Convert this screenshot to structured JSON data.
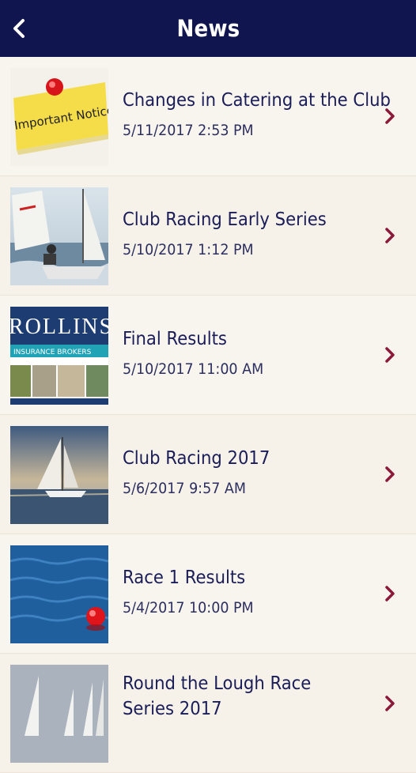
{
  "header": {
    "title": "News",
    "back_icon": "chevron-left-icon"
  },
  "colors": {
    "navbar": "#11154f",
    "title_text": "#1b1d58",
    "chevron": "#8b1a3a"
  },
  "news": [
    {
      "title": "Changes in Catering at the Club",
      "date": "5/11/2017 2:53 PM",
      "thumb_text": "Important Notice"
    },
    {
      "title": "Club Racing Early Series",
      "date": "5/10/2017 1:12 PM"
    },
    {
      "title": "Final Results",
      "date": "5/10/2017 11:00 AM",
      "thumb_text": "ROLLINS",
      "thumb_sub": "INSURANCE BROKERS"
    },
    {
      "title": "Club Racing 2017",
      "date": "5/6/2017 9:57 AM"
    },
    {
      "title": "Race 1 Results",
      "date": "5/4/2017 10:00 PM"
    },
    {
      "title": "Round the Lough Race Series 2017",
      "date": ""
    }
  ]
}
